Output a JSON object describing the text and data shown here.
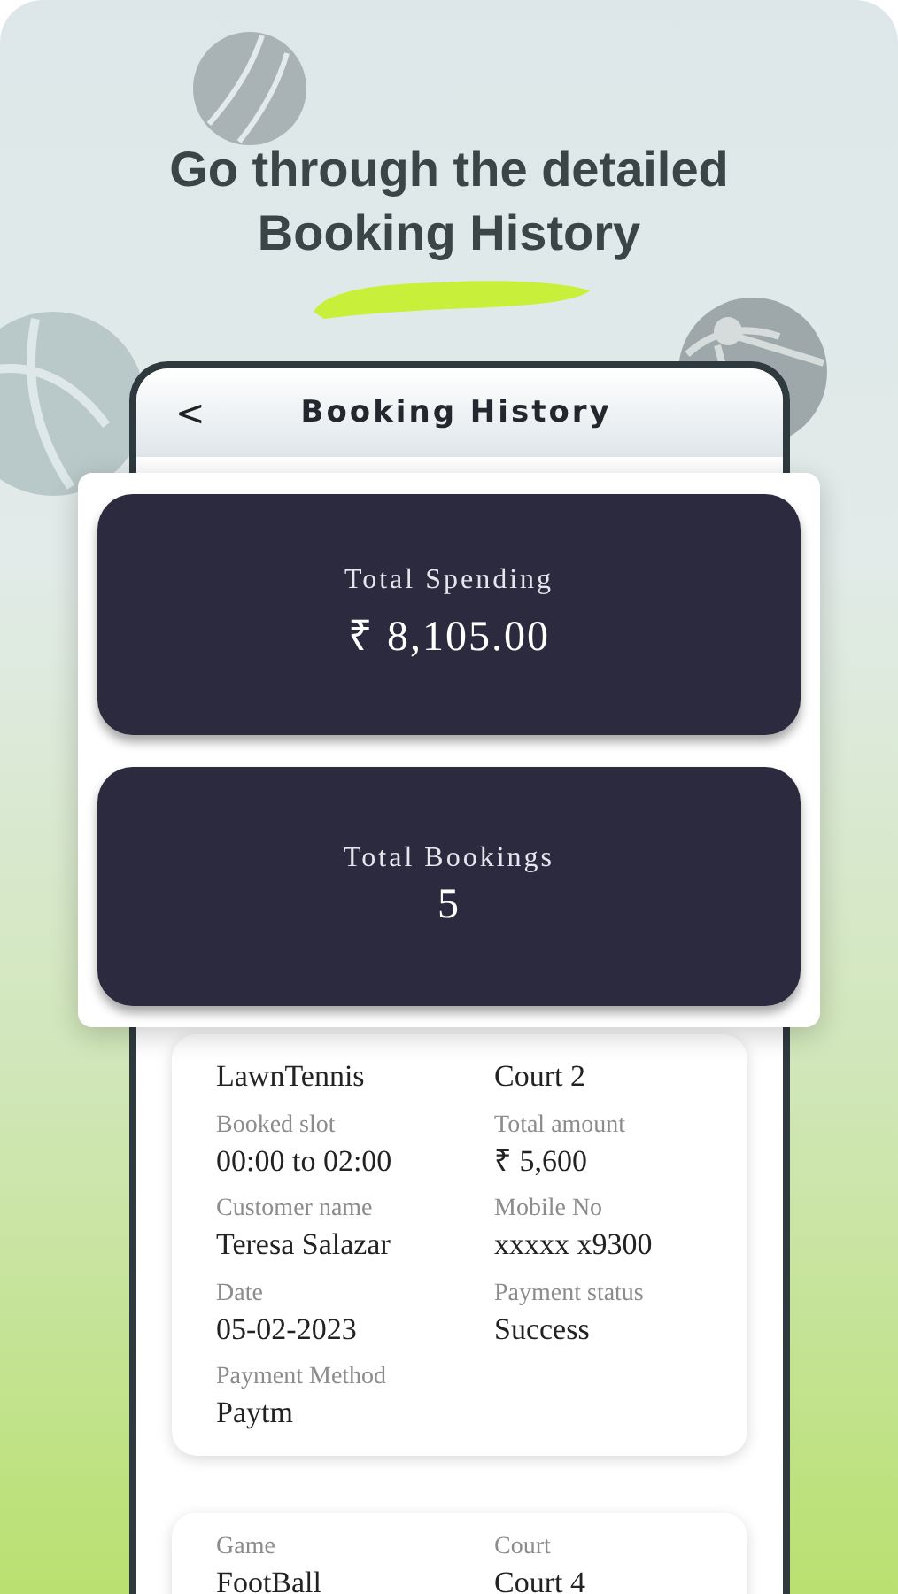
{
  "headline": [
    "Go through the detailed",
    "Booking History"
  ],
  "header": {
    "back": "<",
    "title": "Booking History"
  },
  "summary": [
    {
      "label": "Total Spending",
      "value": "₹ 8,105.00"
    },
    {
      "label": "Total Bookings",
      "value": "5"
    }
  ],
  "bookings": [
    {
      "fields": [
        {
          "value": "LawnTennis"
        },
        {
          "value": "Court 2"
        },
        {
          "label": "Booked slot",
          "value": "00:00 to 02:00"
        },
        {
          "label": "Total amount",
          "value": "₹ 5,600"
        },
        {
          "label": "Customer name",
          "value": "Teresa Salazar"
        },
        {
          "label": "Mobile No",
          "value": "xxxxx x9300"
        },
        {
          "label": "Date",
          "value": "05-02-2023"
        },
        {
          "label": "Payment status",
          "value": "Success"
        },
        {
          "label": "Payment Method",
          "value": "Paytm"
        }
      ]
    },
    {
      "fields": [
        {
          "label": "Game",
          "value": "FootBall"
        },
        {
          "label": "Court",
          "value": "Court 4"
        }
      ]
    }
  ]
}
